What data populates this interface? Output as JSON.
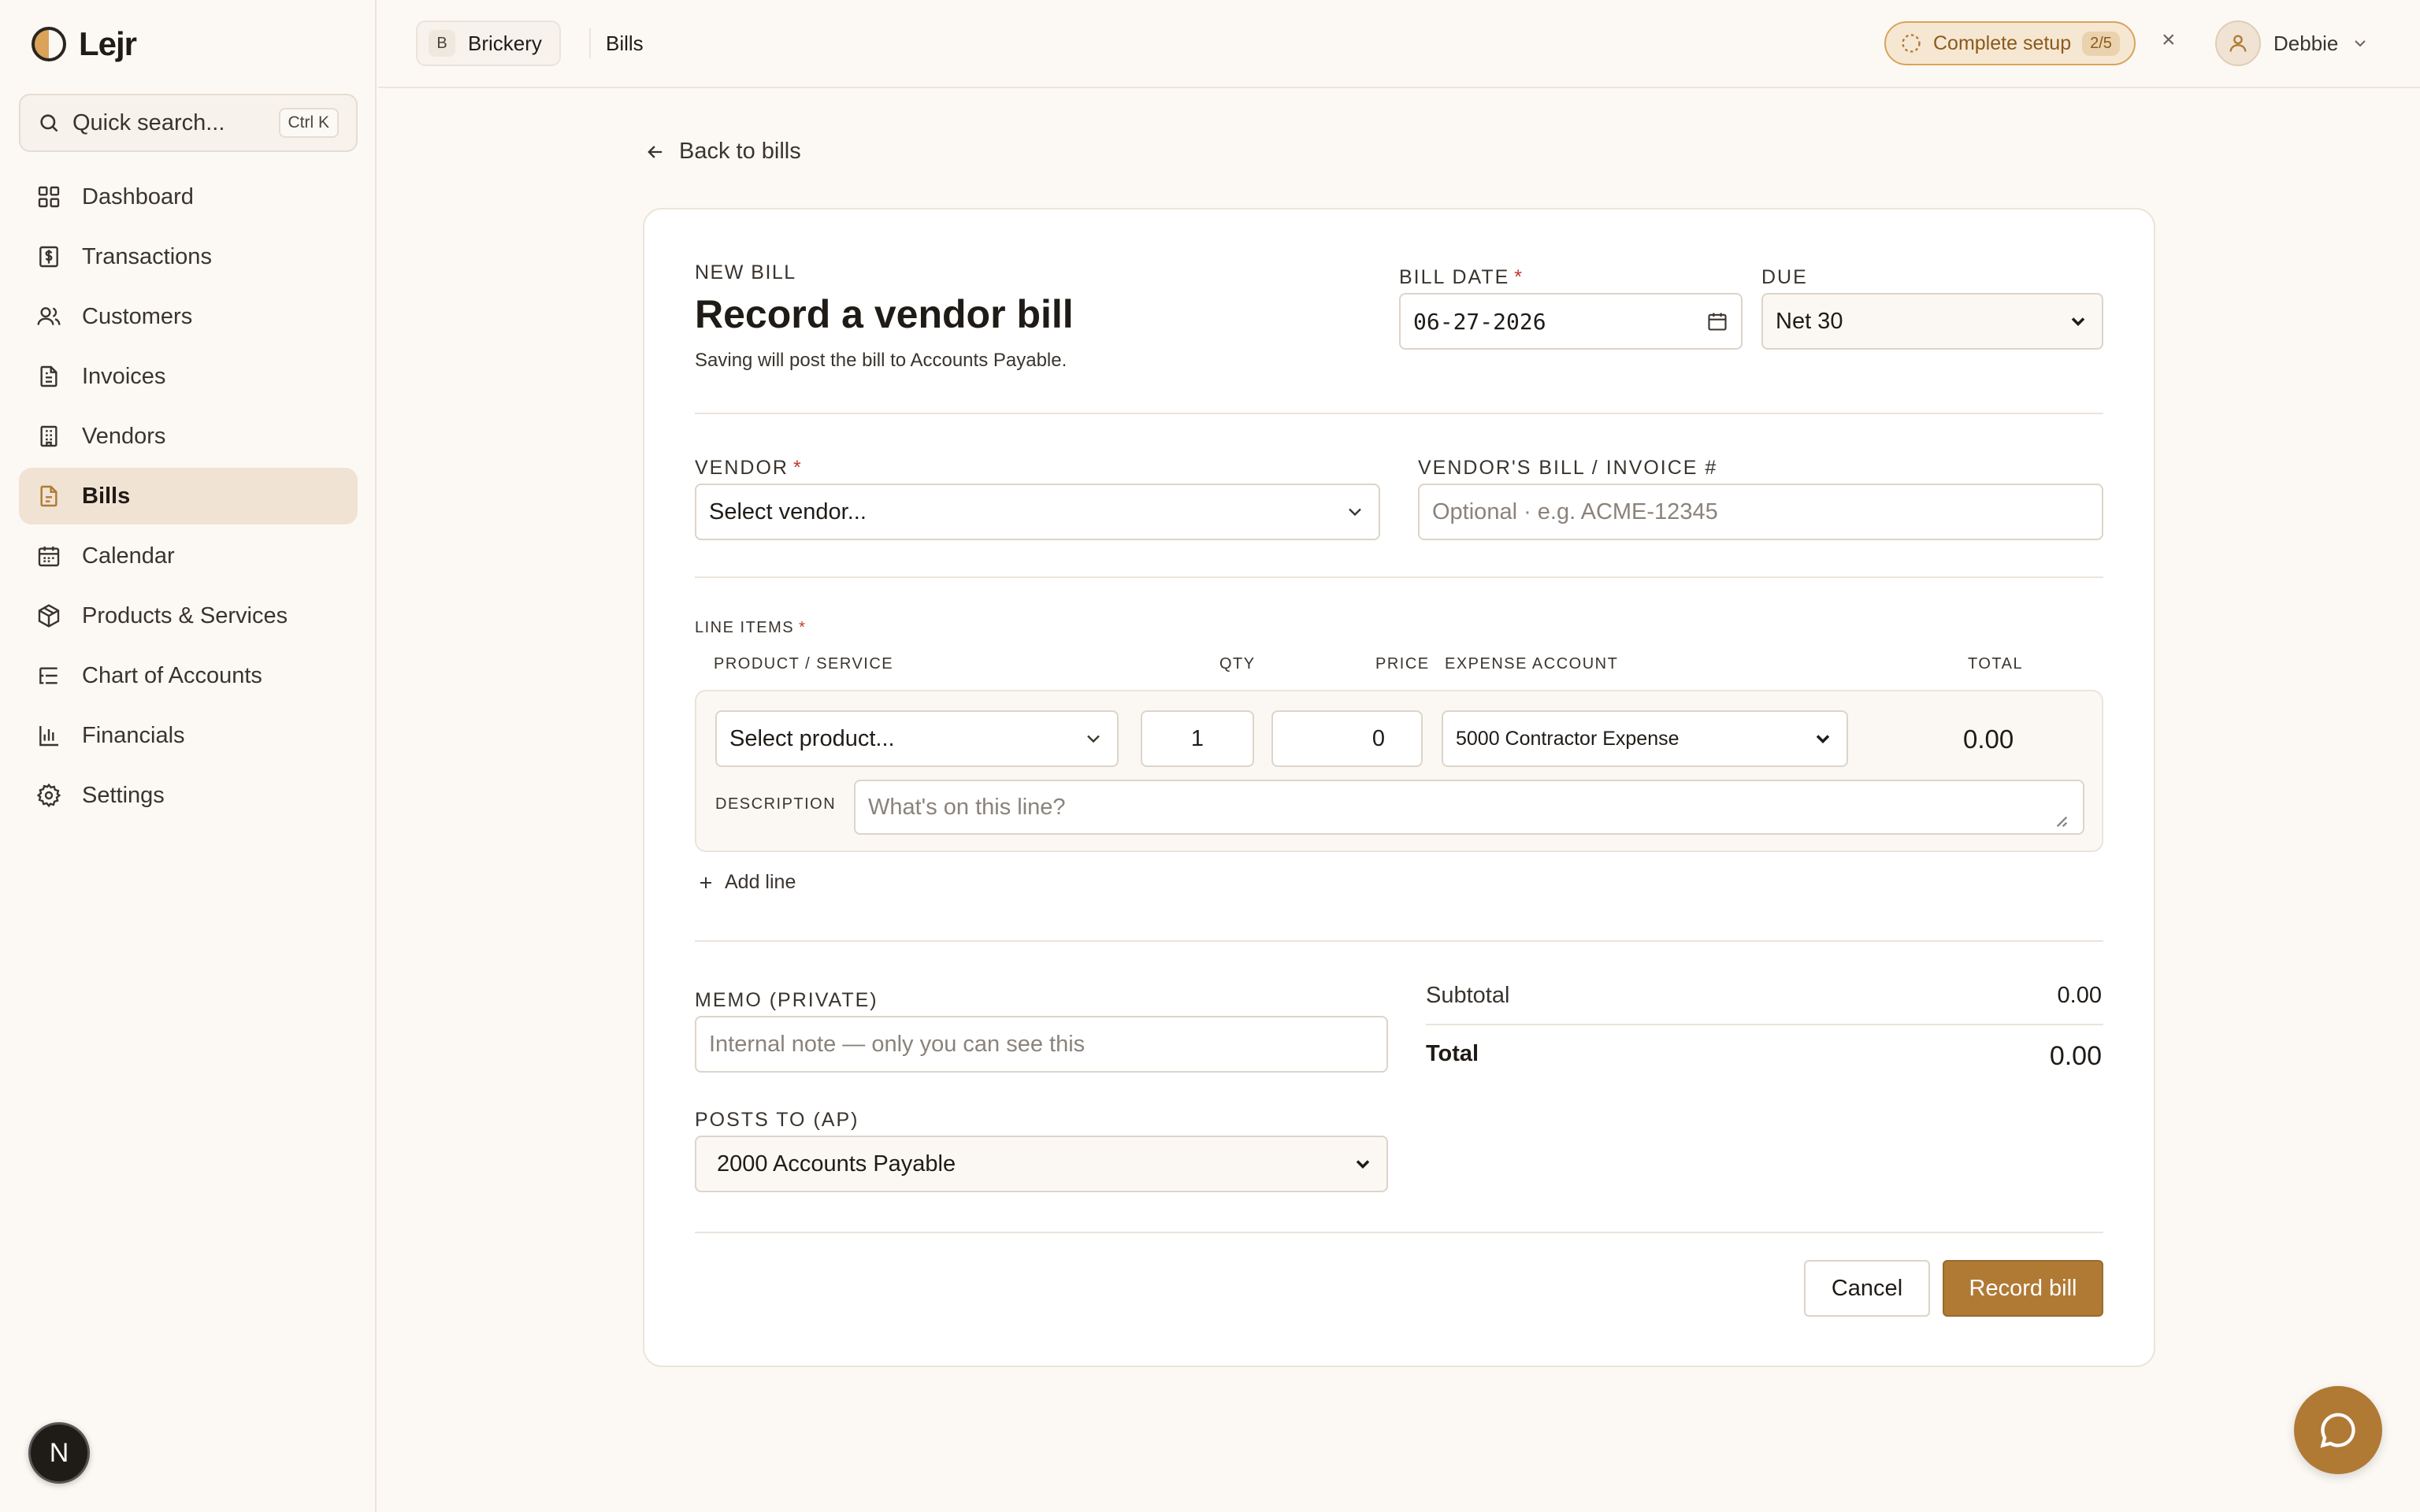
{
  "app": {
    "name": "Lejr"
  },
  "search": {
    "placeholder": "Quick search...",
    "shortcut": "Ctrl K"
  },
  "sidebar": {
    "items": [
      {
        "label": "Dashboard",
        "icon": "grid-icon"
      },
      {
        "label": "Transactions",
        "icon": "receipt-icon"
      },
      {
        "label": "Customers",
        "icon": "users-icon"
      },
      {
        "label": "Invoices",
        "icon": "document-icon"
      },
      {
        "label": "Vendors",
        "icon": "building-icon"
      },
      {
        "label": "Bills",
        "icon": "file-icon",
        "active": true
      },
      {
        "label": "Calendar",
        "icon": "calendar-icon"
      },
      {
        "label": "Products & Services",
        "icon": "box-icon"
      },
      {
        "label": "Chart of Accounts",
        "icon": "list-tree-icon"
      },
      {
        "label": "Financials",
        "icon": "bar-chart-icon"
      },
      {
        "label": "Settings",
        "icon": "gear-icon"
      }
    ],
    "bottom_avatar": "N"
  },
  "topbar": {
    "org_initial": "B",
    "org_name": "Brickery",
    "breadcrumb": "Bills",
    "setup_label": "Complete setup",
    "setup_progress": "2/5",
    "close_symbol": "×",
    "user_name": "Debbie"
  },
  "page": {
    "back_label": "Back to bills",
    "eyebrow": "NEW BILL",
    "title": "Record a vendor bill",
    "subtitle": "Saving will post the bill to Accounts Payable."
  },
  "form": {
    "bill_date_label": "BILL DATE",
    "bill_date_value": "06-27-2026",
    "due_label": "DUE",
    "due_value": "Net 30",
    "vendor_label": "VENDOR",
    "vendor_placeholder": "Select vendor...",
    "invoice_label": "VENDOR'S BILL / INVOICE #",
    "invoice_placeholder": "Optional · e.g. ACME-12345",
    "line_items_label": "LINE ITEMS",
    "columns": {
      "product": "PRODUCT / SERVICE",
      "qty": "QTY",
      "price": "PRICE",
      "account": "EXPENSE ACCOUNT",
      "total": "TOTAL"
    },
    "line": {
      "product_placeholder": "Select product...",
      "qty": "1",
      "price": "0",
      "account": "5000 Contractor Expense",
      "total": "0.00",
      "description_label": "DESCRIPTION",
      "description_placeholder": "What's on this line?"
    },
    "add_line_label": "Add line",
    "memo_label": "MEMO (PRIVATE)",
    "memo_placeholder": "Internal note — only you can see this",
    "posts_to_label": "POSTS TO (AP)",
    "posts_to_value": "2000 Accounts Payable",
    "subtotal_label": "Subtotal",
    "subtotal_value": "0.00",
    "total_label": "Total",
    "total_value": "0.00",
    "required_mark": "*"
  },
  "actions": {
    "cancel": "Cancel",
    "submit": "Record bill"
  },
  "colors": {
    "accent": "#b07a35",
    "background": "#fcf9f5",
    "active_nav": "#f1e3d3",
    "required": "#c0392b"
  }
}
